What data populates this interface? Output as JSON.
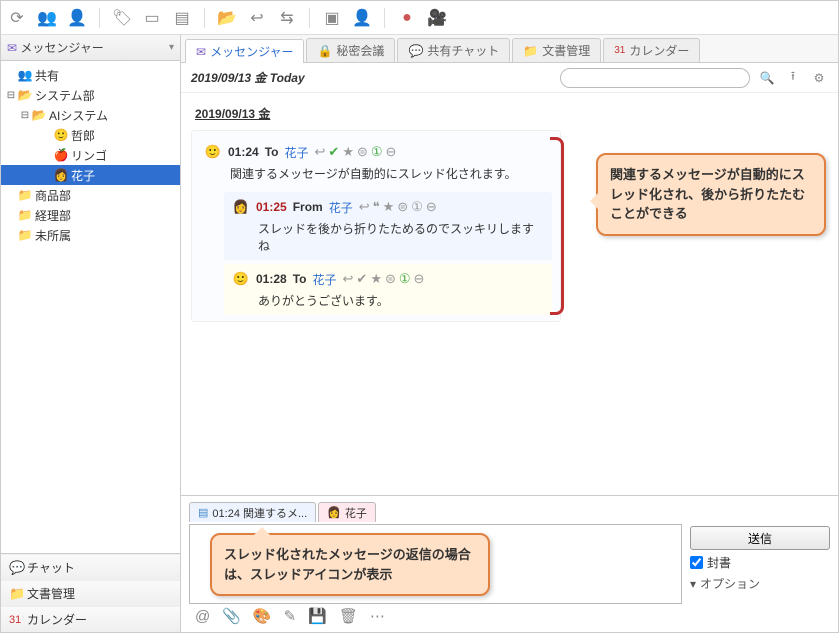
{
  "sidebar": {
    "header": "メッセンジャー",
    "share_label": "共有",
    "tree": {
      "system": "システム部",
      "ai": "AIシステム",
      "tetsuro": "哲郎",
      "ringo": "リンゴ",
      "hanako": "花子",
      "sales": "商品部",
      "accounting": "経理部",
      "unassigned": "未所属"
    },
    "bottom": {
      "chat": "チャット",
      "docs": "文書管理",
      "calendar": "カレンダー"
    }
  },
  "tabs": {
    "messenger": "メッセンジャー",
    "secret": "秘密会議",
    "shared": "共有チャット",
    "docs": "文書管理",
    "calendar": "カレンダー"
  },
  "datebar": {
    "date": "2019/09/13 金 Today",
    "search_placeholder": ""
  },
  "thread": {
    "date_header": "2019/09/13 金",
    "messages": [
      {
        "time": "01:24",
        "dir": "To",
        "name": "花子",
        "body": "関連するメッセージが自動的にスレッド化されます。"
      },
      {
        "time": "01:25",
        "dir": "From",
        "name": "花子",
        "body": "スレッドを後から折りたためるのでスッキリしますね"
      },
      {
        "time": "01:28",
        "dir": "To",
        "name": "花子",
        "body": "ありがとうございます。"
      }
    ]
  },
  "callouts": {
    "c1": "関連するメッセージが自動的にスレッド化され、後から折りたたむことができる",
    "c2": "スレッド化されたメッセージの返信の場合は、スレッドアイコンが表示"
  },
  "compose": {
    "tab1": "01:24 関連するメ...",
    "tab2": "花子",
    "send": "送信",
    "sealed": "封書",
    "options": "オプション"
  }
}
